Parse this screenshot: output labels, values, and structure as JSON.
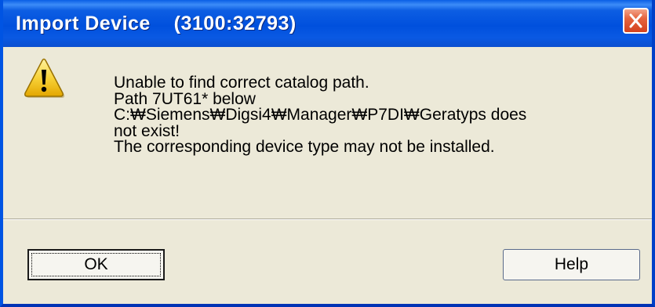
{
  "dialog": {
    "title": "Import Device    (3100:32793)",
    "icon": "warning-icon",
    "message_lines": [
      "Unable to find correct catalog path.",
      "Path 7UT61* below",
      "C:₩Siemens₩Digsi4₩Manager₩P7DI₩Geratyps does",
      "not exist!",
      "The corresponding device type may not be installed."
    ],
    "buttons": {
      "ok_label": "OK",
      "help_label": "Help"
    }
  },
  "colors": {
    "titlebar": "#0054e3",
    "close_button": "#e5633e",
    "dialog_body": "#ece9d8",
    "warning_fill": "#f8d33a"
  }
}
